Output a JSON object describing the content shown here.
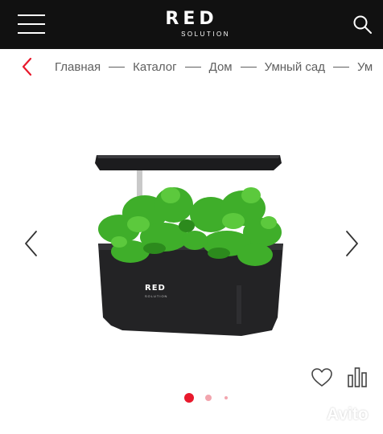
{
  "header": {
    "logo_main": "RED",
    "logo_sub": "SOLUTION",
    "menu_icon": "hamburger-menu-icon",
    "search_icon": "search-icon",
    "background": "#111111"
  },
  "breadcrumbs": {
    "back_icon": "chevron-left-icon",
    "accent": "#e8192c",
    "items": [
      "Главная",
      "Каталог",
      "Дом",
      "Умный сад",
      "Ум"
    ]
  },
  "gallery": {
    "image_label": "RED",
    "image_sublabel": "SOLUTION",
    "prev_icon": "chevron-left-icon",
    "next_icon": "chevron-right-icon",
    "favorite_icon": "heart-icon",
    "compare_icon": "bar-chart-icon",
    "active_slide": 1,
    "slide_count": 3
  },
  "watermark": {
    "text": "Avito"
  }
}
